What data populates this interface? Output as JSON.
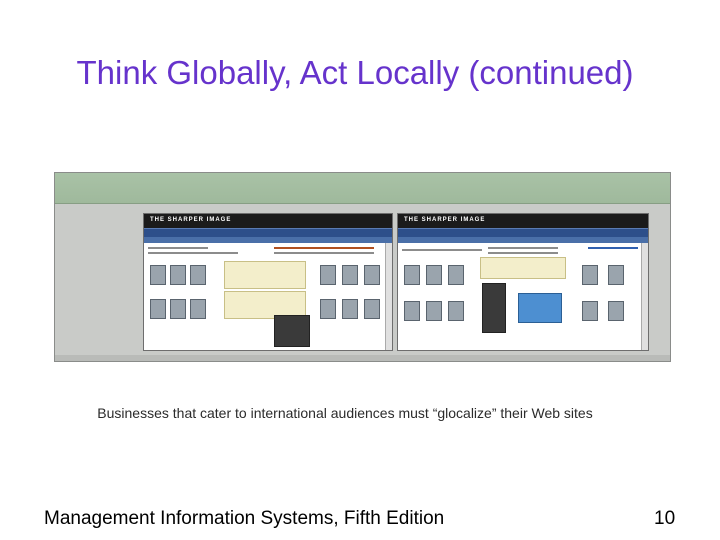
{
  "slide": {
    "title": "Think Globally, Act Locally (continued)",
    "caption": "Businesses that cater to international audiences must “glocalize” their Web sites",
    "footer_text": "Management Information Systems, Fifth Edition",
    "page_number": "10"
  },
  "screenshot": {
    "left_site_brand": "THE SHARPER IMAGE",
    "right_site_brand": "THE SHARPER IMAGE"
  },
  "colors": {
    "title": "#6633cc",
    "screenshot_band": "#a9c2a6",
    "site_nav": "#2d4f8a"
  }
}
